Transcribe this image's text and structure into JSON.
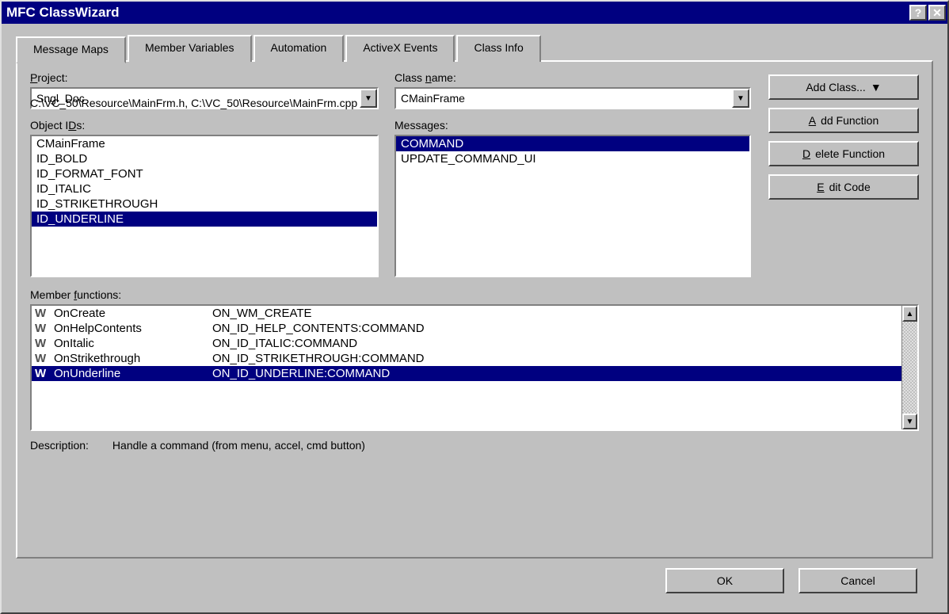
{
  "window": {
    "title": "MFC ClassWizard"
  },
  "tabs": [
    {
      "label": "Message Maps",
      "active": true
    },
    {
      "label": "Member Variables",
      "active": false
    },
    {
      "label": "Automation",
      "active": false
    },
    {
      "label": "ActiveX Events",
      "active": false
    },
    {
      "label": "Class Info",
      "active": false
    }
  ],
  "labels": {
    "project": "Project:",
    "class_name": "Class name:",
    "object_ids": "Object IDs:",
    "messages": "Messages:",
    "member_functions": "Member functions:",
    "description_label": "Description:"
  },
  "project": {
    "value": "Sngl_Doc"
  },
  "class_name": {
    "value": "CMainFrame"
  },
  "file_path": "C:\\VC_50\\Resource\\MainFrm.h, C:\\VC_50\\Resource\\MainFrm.cpp",
  "object_ids": {
    "items": [
      "CMainFrame",
      "ID_BOLD",
      "ID_FORMAT_FONT",
      "ID_ITALIC",
      "ID_STRIKETHROUGH",
      "ID_UNDERLINE"
    ],
    "selected_index": 5
  },
  "messages": {
    "items": [
      "COMMAND",
      "UPDATE_COMMAND_UI"
    ],
    "selected_index": 0
  },
  "member_functions": {
    "items": [
      {
        "prefix": "W",
        "name": "OnCreate",
        "msg": "ON_WM_CREATE"
      },
      {
        "prefix": "W",
        "name": "OnHelpContents",
        "msg": "ON_ID_HELP_CONTENTS:COMMAND"
      },
      {
        "prefix": "W",
        "name": "OnItalic",
        "msg": "ON_ID_ITALIC:COMMAND"
      },
      {
        "prefix": "W",
        "name": "OnStrikethrough",
        "msg": "ON_ID_STRIKETHROUGH:COMMAND"
      },
      {
        "prefix": "W",
        "name": "OnUnderline",
        "msg": "ON_ID_UNDERLINE:COMMAND"
      }
    ],
    "selected_index": 4
  },
  "description": {
    "text": "Handle a command (from menu, accel, cmd button)"
  },
  "buttons": {
    "add_class": "Add Class...",
    "add_function": "Add Function",
    "delete_function": "Delete Function",
    "edit_code": "Edit Code",
    "ok": "OK",
    "cancel": "Cancel"
  }
}
